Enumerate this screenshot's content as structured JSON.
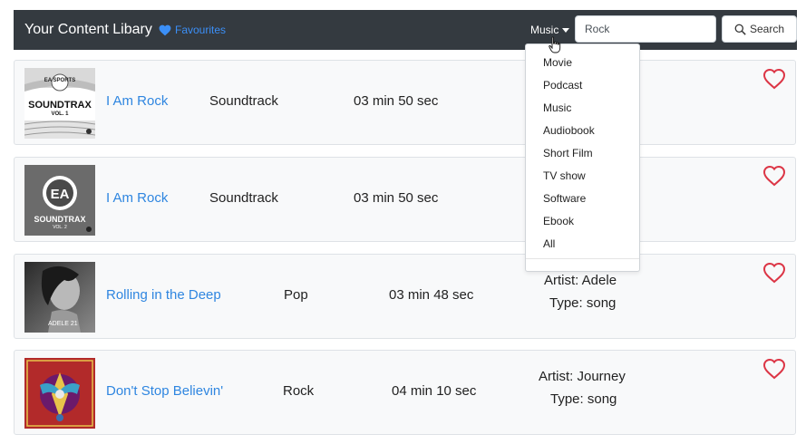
{
  "navbar": {
    "brand": "Your Content Libary",
    "favourites": "Favourites",
    "category_label": "Music",
    "search_value": "Rock",
    "search_button": "Search"
  },
  "dropdown": {
    "items": [
      "Movie",
      "Podcast",
      "Music",
      "Audiobook",
      "Short Film",
      "TV show",
      "Software",
      "Ebook",
      "All"
    ]
  },
  "cards": [
    {
      "title": "I Am Rock",
      "genre": "Soundtrack",
      "duration": "03 min 50 sec",
      "artist": "",
      "type": ""
    },
    {
      "title": "I Am Rock",
      "genre": "Soundtrack",
      "duration": "03 min 50 sec",
      "artist": "",
      "type": ""
    },
    {
      "title": "Rolling in the Deep",
      "genre": "Pop",
      "duration": "03 min 48 sec",
      "artist": "Artist: Adele",
      "type": "Type: song"
    },
    {
      "title": "Don't Stop Believin'",
      "genre": "Rock",
      "duration": "04 min 10 sec",
      "artist": "Artist: Journey",
      "type": "Type: song"
    }
  ],
  "art_text": {
    "c1_brand": "EA SPORTS",
    "c1_title": "SOUNDTRAX",
    "c1_vol": "VOL. 1",
    "c2_brand": "EA",
    "c2_title": "SOUNDTRAX",
    "c2_vol": "VOL. 2",
    "c3_caption": "ADELE 21"
  },
  "colors": {
    "navbar": "#343a40",
    "link": "#2f86e0",
    "heart": "#dc3545",
    "card_bg": "#f8f9fa"
  }
}
